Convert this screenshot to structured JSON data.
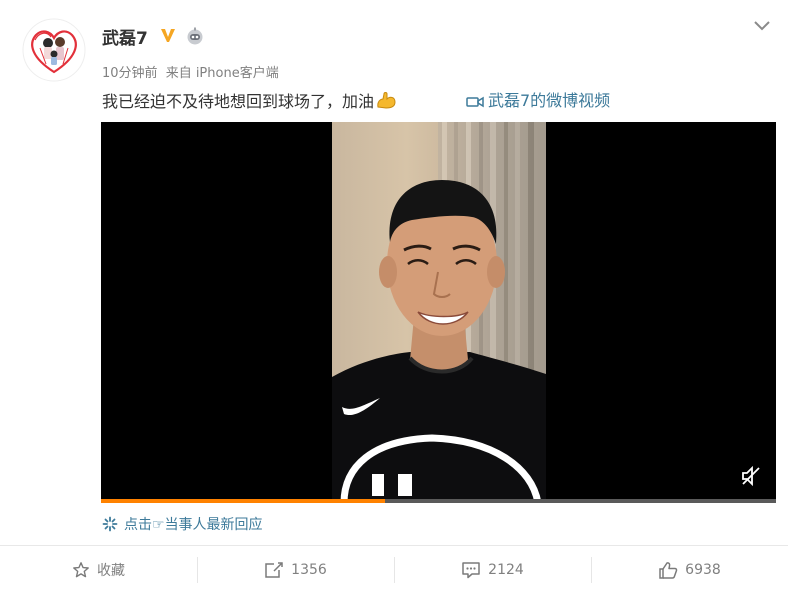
{
  "post": {
    "username": "武磊7",
    "time": "10分钟前",
    "source": "来自 iPhone客户端",
    "text": "我已经迫不及待地想回到球场了，加油",
    "video_link": "武磊7的微博视频",
    "responses_label": "点击☞当事人最新回应"
  },
  "video": {
    "progress": 0.42
  },
  "toolbar": {
    "favorite_label": "收藏",
    "repost_count": "1356",
    "comment_count": "2124",
    "like_count": "6938"
  },
  "colors": {
    "link": "#3d7a9a",
    "progress": "#ff8200",
    "verified": "#f5a623"
  },
  "icons": {
    "verified": "verified-v-icon",
    "robot": "robot-badge-icon",
    "caret": "chevron-down-icon",
    "emoji": "flexed-arm-emoji",
    "video": "video-camera-icon",
    "mute": "mute-icon",
    "favorite": "star-icon",
    "repost": "repost-icon",
    "comment": "comment-icon",
    "like": "thumbs-up-icon"
  }
}
